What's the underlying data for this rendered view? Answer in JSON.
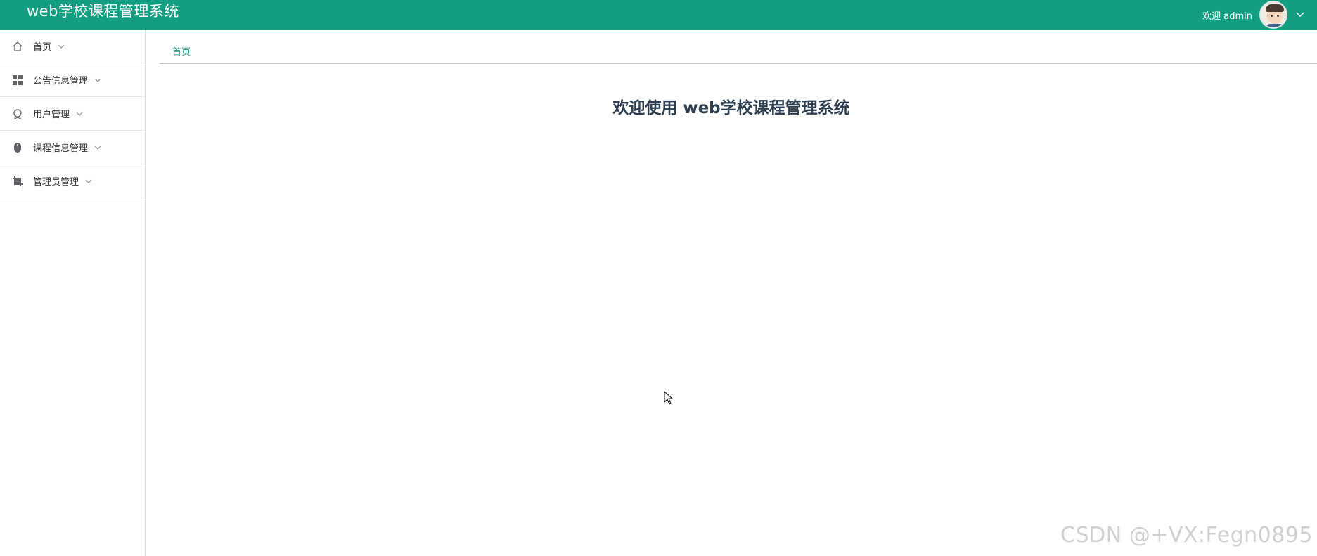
{
  "header": {
    "title": "web学校课程管理系统",
    "welcome": "欢迎 admin",
    "avatar_icon": "user-avatar",
    "caret_icon": "chevron-down-icon",
    "background": "#139e82"
  },
  "sidebar": {
    "items": [
      {
        "label": "首页",
        "icon": "home-icon"
      },
      {
        "label": "公告信息管理",
        "icon": "grid-icon"
      },
      {
        "label": "用户管理",
        "icon": "badge-icon"
      },
      {
        "label": "课程信息管理",
        "icon": "mouse-icon"
      },
      {
        "label": "管理员管理",
        "icon": "crop-icon"
      }
    ]
  },
  "breadcrumb": {
    "home": "首页"
  },
  "main": {
    "welcome_title": "欢迎使用 web学校课程管理系统"
  },
  "watermark": "CSDN @+VX:Fegn0895",
  "colors": {
    "accent": "#139e82",
    "title_text": "#2c3e50"
  }
}
